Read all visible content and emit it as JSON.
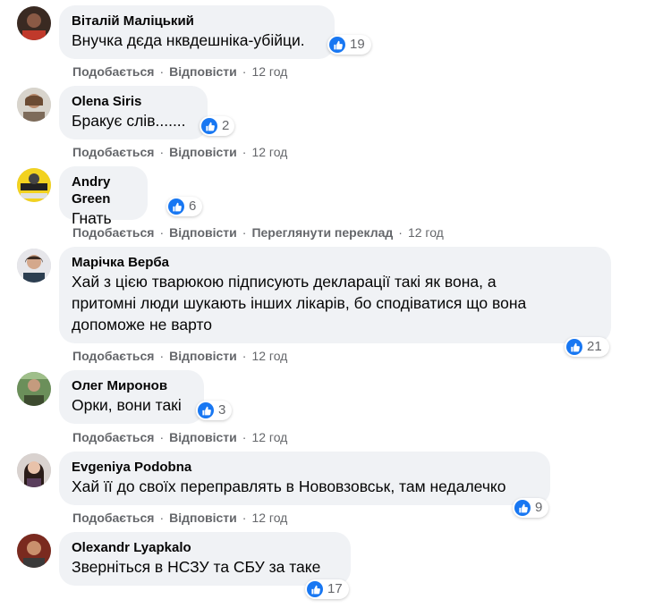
{
  "colors": {
    "bubble": "#f0f2f5",
    "like": "#1877f2",
    "meta": "#65676b",
    "text": "#050505"
  },
  "actions": {
    "like": "Подобається",
    "reply": "Відповісти",
    "translate": "Переглянути переклад",
    "separator": "·"
  },
  "comments": [
    {
      "author": "Віталій Маліцький",
      "lines": [
        "Внучка дєда нквдешніка-убійци."
      ],
      "reactions": "19",
      "time": "12 год"
    },
    {
      "author": "Olena Siris",
      "lines": [
        "Бракує слів......."
      ],
      "reactions": "2",
      "time": "12 год"
    },
    {
      "author": "Andry Green",
      "lines": [
        "Гнать"
      ],
      "reactions": "6",
      "time": "12 год"
    },
    {
      "author": "Марічка Верба",
      "lines": [
        "Хай з цією тварюкою підписують декларації такі як вона, а",
        "притомні люди шукають інших лікарів, бо сподіватися що вона",
        "допоможе не варто"
      ],
      "reactions": "21",
      "time": "12 год"
    },
    {
      "author": "Олег Миронов",
      "lines": [
        "Орки, вони такі"
      ],
      "reactions": "3",
      "time": "12 год"
    },
    {
      "author": "Evgeniya Podobna",
      "lines": [
        "Хай її до своїх переправлять в Нововзовськ, там недалечко"
      ],
      "reactions": "9",
      "time": "12 год"
    },
    {
      "author": "Olexandr Lyapkalo",
      "lines": [
        "Зверніться в НСЗУ та СБУ за таке"
      ],
      "reactions": "17",
      "time": "12 год"
    }
  ]
}
